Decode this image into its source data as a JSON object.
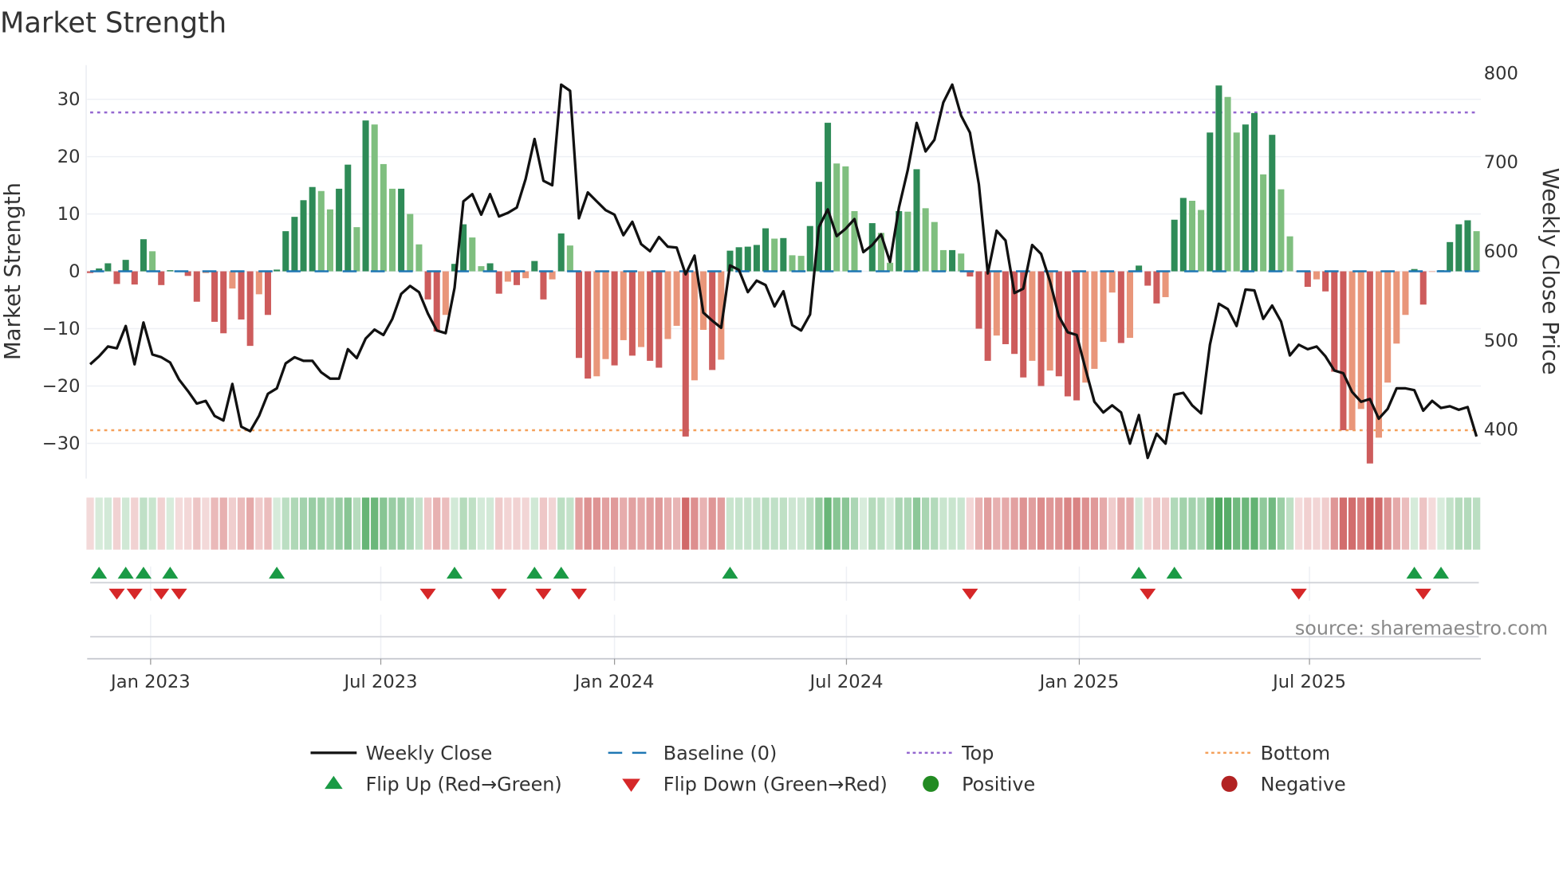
{
  "title": "Market Strength",
  "source": "source: sharemaestro.com",
  "colors": {
    "strong_up": "#2e8b57",
    "weak_up": "#7fbf7f",
    "strong_down": "#cd5c5c",
    "weak_down": "#e9967a",
    "line": "#111111",
    "baseline": "#1f77b4",
    "top": "#9467d0",
    "bottom": "#f4a05a",
    "flip_up": "#1a9a45",
    "flip_down": "#d62728",
    "positive": "#228b22",
    "negative": "#b22222"
  },
  "legend": [
    {
      "label": "Weekly Close",
      "kind": "line"
    },
    {
      "label": "Baseline (0)",
      "kind": "baseline"
    },
    {
      "label": "Top",
      "kind": "top"
    },
    {
      "label": "Bottom",
      "kind": "bottom"
    },
    {
      "label": "Flip Up (Red→Green)",
      "kind": "flip_up"
    },
    {
      "label": "Flip Down (Green→Red)",
      "kind": "flip_down"
    },
    {
      "label": "Positive",
      "kind": "positive"
    },
    {
      "label": "Negative",
      "kind": "negative"
    }
  ],
  "chart_data": {
    "type": "bar",
    "title": "Market Strength",
    "start_date": "2022-11-14",
    "interval": "weekly",
    "x_range_weeks": [
      -0.34,
      156.5
    ],
    "x_ticks": [
      {
        "label": "Jan 2023",
        "week": 6.8
      },
      {
        "label": "Jul 2023",
        "week": 32.7
      },
      {
        "label": "Jan 2024",
        "week": 59.0
      },
      {
        "label": "Jul 2024",
        "week": 85.1
      },
      {
        "label": "Jan 2025",
        "week": 111.3
      },
      {
        "label": "Jul 2025",
        "week": 137.2
      }
    ],
    "y_left": {
      "label": "Market Strength",
      "range": [
        -36.1,
        36
      ],
      "ticks": [
        -30,
        -20,
        -10,
        0,
        10,
        20,
        30
      ]
    },
    "y_right": {
      "label": "Weekly Close Price",
      "range": [
        343.8,
        807.9
      ],
      "ticks": [
        400,
        500,
        600,
        700,
        800
      ]
    },
    "grid": true,
    "baseline": 0,
    "top_level": 27.7,
    "bottom_level": -27.7,
    "strength": [
      -0.3,
      0.5,
      1.4,
      -2.2,
      2,
      -2.3,
      5.6,
      3.5,
      -2.4,
      0.2,
      -0.1,
      -0.8,
      -5.3,
      -0.3,
      -8.8,
      -10.8,
      -3,
      -8.4,
      -13,
      -4,
      -7.6,
      0.3,
      7,
      9.5,
      12.4,
      14.7,
      14,
      10.8,
      14.4,
      18.6,
      7.7,
      26.3,
      25.6,
      18.7,
      14.4,
      14.4,
      10,
      4.7,
      -4.9,
      -10.5,
      -7.6,
      1.3,
      8.2,
      5.9,
      0.9,
      1.4,
      -3.9,
      -1.8,
      -2.4,
      -1.2,
      1.8,
      -4.9,
      -1.4,
      6.6,
      4.5,
      -15.1,
      -18.7,
      -18.3,
      -15.3,
      -16.4,
      -12,
      -14.7,
      -13.2,
      -15.6,
      -16.8,
      -11.8,
      -9.5,
      -28.8,
      -19,
      -10.2,
      -17.2,
      -15.4,
      3.6,
      4.2,
      4.3,
      4.6,
      7.5,
      5.7,
      5.8,
      2.8,
      2.7,
      7.9,
      15.6,
      25.9,
      18.8,
      18.3,
      10.5,
      0,
      8.4,
      6.7,
      1.5,
      10.5,
      10.4,
      17.8,
      11,
      8.6,
      3.7,
      3.7,
      3.1,
      -0.9,
      -10,
      -15.6,
      -11.2,
      -12.7,
      -14.4,
      -18.5,
      -15.6,
      -20,
      -17.3,
      -18.3,
      -21.8,
      -22.5,
      -19.4,
      -17,
      -12.3,
      -3.7,
      -12.5,
      -11.6,
      1,
      -2.5,
      -5.6,
      -4.5,
      9,
      12.8,
      12.3,
      10.7,
      24.2,
      32.4,
      30.4,
      24.2,
      25.6,
      27.6,
      16.9,
      23.8,
      14.3,
      6.1,
      -0.1,
      -2.7,
      -1.4,
      -3.5,
      -17.5,
      -27.7,
      -27.7,
      -24,
      -33.5,
      -29,
      -19.4,
      -12.6,
      -7.6,
      0.4,
      -5.8,
      -0.1,
      0.2,
      5.1,
      8.2,
      8.9,
      7
    ],
    "weekly_close": [
      472,
      481,
      492,
      490,
      515,
      472,
      519,
      483,
      480,
      474,
      455,
      442,
      428,
      431,
      414,
      409,
      450,
      402,
      397,
      414,
      439,
      445,
      473,
      480,
      476,
      476,
      463,
      456,
      456,
      489,
      479,
      501,
      511,
      505,
      523,
      551,
      560,
      553,
      529,
      510,
      507,
      558,
      655,
      663,
      640,
      663,
      638,
      642,
      648,
      680,
      725,
      678,
      673,
      786,
      779,
      636,
      665,
      655,
      645,
      640,
      617,
      632,
      607,
      599,
      615,
      604,
      603,
      573,
      594,
      530,
      521,
      513,
      583,
      578,
      553,
      566,
      561,
      537,
      554,
      516,
      510,
      528,
      626,
      646,
      616,
      624,
      635,
      598,
      606,
      618,
      587,
      648,
      690,
      743,
      711,
      724,
      766,
      786,
      751,
      732,
      674,
      574,
      622,
      611,
      552,
      557,
      606,
      596,
      565,
      526,
      508,
      505,
      467,
      430,
      418,
      426,
      418,
      383,
      415,
      367,
      394,
      383,
      438,
      440,
      426,
      417,
      494,
      540,
      534,
      515,
      556,
      555,
      523,
      538,
      520,
      482,
      494,
      489,
      492,
      481,
      465,
      462,
      441,
      430,
      433,
      411,
      422,
      445,
      445,
      443,
      420,
      431,
      423,
      425,
      421,
      424,
      391
    ],
    "flip_up_weeks": [
      1,
      4,
      6,
      9,
      21,
      41,
      50,
      53,
      72,
      118,
      122,
      149,
      152
    ],
    "flip_down_weeks": [
      3,
      5,
      8,
      10,
      38,
      46,
      51,
      55,
      99,
      119,
      136,
      150
    ]
  }
}
